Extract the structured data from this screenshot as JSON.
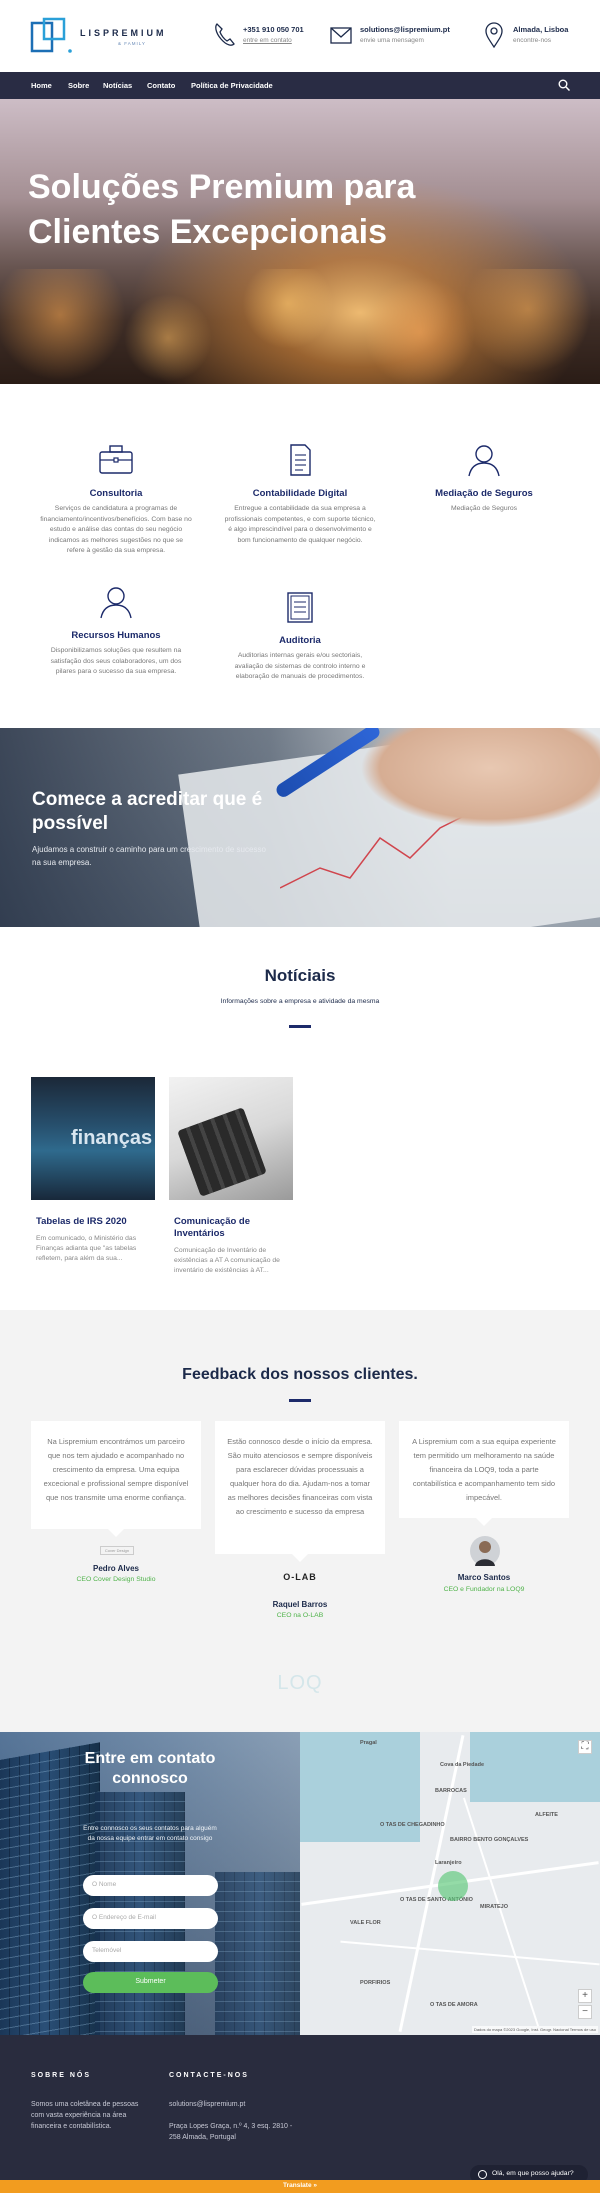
{
  "header": {
    "logo_text": "LISPREMIUM",
    "logo_sub": "& FAMILY",
    "phone": {
      "number": "+351 910 050 701",
      "sub": "entre em contato"
    },
    "email": {
      "address": "solutions@lispremium.pt",
      "sub": "envie uma mensagem"
    },
    "location": {
      "city": "Almada, Lisboa",
      "sub": "encontre-nos"
    }
  },
  "nav": {
    "items": [
      "Home",
      "Sobre",
      "Notícias",
      "Contato",
      "Política de Privacidade"
    ]
  },
  "hero": {
    "title": "Soluções Premium para Clientes Excepcionais"
  },
  "services": [
    {
      "icon": "briefcase-icon",
      "title": "Consultoria",
      "desc": "Serviços de candidatura a programas de financiamento/incentivos/benefícios. Com base no estudo e análise das contas do seu negócio indicamos as melhores sugestões no que se refere à gestão da sua empresa."
    },
    {
      "icon": "document-icon",
      "title": "Contabilidade Digital",
      "desc": "Entregue a contabilidade da sua empresa a profissionais competentes, e com suporte técnico, é algo imprescindível para o desenvolvimento e bom funcionamento de qualquer negócio."
    },
    {
      "icon": "user-icon",
      "title": "Mediação de Seguros",
      "desc": "Mediação de Seguros"
    },
    {
      "icon": "person-icon",
      "title": "Recursos Humanos",
      "desc": "Disponibilizamos soluções que resultem na satisfação dos seus colaboradores, um dos pilares para o sucesso da sua empresa."
    },
    {
      "icon": "clipboard-icon",
      "title": "Auditoria",
      "desc": "Auditorias internas gerais e/ou sectoriais, avaliação de sistemas de controlo interno e elaboração de manuais de procedimentos."
    }
  ],
  "banner": {
    "title": "Comece a acreditar que é possível",
    "text": "Ajudamos a construir o caminho para um crescimento de sucesso na sua empresa."
  },
  "news": {
    "title": "Notíciais",
    "subtitle": "Informações sobre a empresa e atividade da mesma",
    "cards": [
      {
        "title": "Tabelas de IRS 2020",
        "desc": "Em comunicado, o Ministério das Finanças adianta que \"as tabelas refletem, para além da sua...",
        "image_text": "finanças"
      },
      {
        "title": "Comunicação de Inventários",
        "desc": "Comunicação de Inventário de existências a AT A comunicação de inventário de existências à AT..."
      }
    ]
  },
  "feedback": {
    "title": "Feedback dos nossos clientes.",
    "testimonials": [
      {
        "text": "Na Lispremium encontrámos um parceiro que nos tem ajudado e acompanhado no crescimento da empresa. Uma equipa excecional e profissional sempre disponível que nos transmite uma enorme confiança.",
        "logo": "Cover Design",
        "name": "Pedro Alves",
        "role": "CEO Cover Design Studio"
      },
      {
        "text": "Estão connosco desde o início da empresa. São muito atenciosos e sempre disponíveis para esclarecer dúvidas processuais a qualquer hora do dia. Ajudam-nos a tomar as melhores decisões financeiras com vista ao crescimento e sucesso da empresa",
        "logo": "O-LAB",
        "name": "Raquel Barros",
        "role": "CEO na O-LAB"
      },
      {
        "text": "A Lispremium com a sua equipa experiente tem permitido um melhoramento na saúde financeira da LOQ9, toda a parte contabilística e acompanhamento tem sido impecável.",
        "logo": "",
        "name": "Marco Santos",
        "role": "CEO e Fundador na LOQ9"
      }
    ],
    "extra_logo": "LOQ"
  },
  "contact": {
    "title": "Entre em contato connosco",
    "lead": "Entre connosco os seus contatos para alguém da nossa equipe entrar em contato consigo",
    "placeholders": {
      "name": "O Nome",
      "email": "O Endereço de E-mail",
      "phone": "Telemóvel"
    },
    "submit": "Submeter"
  },
  "map": {
    "labels": [
      "Pragal",
      "Cova da Piedade",
      "BARROCAS",
      "ALFEITE",
      "O TAS DE CHEGADINHO",
      "BAIRRO BENTO GONÇALVES",
      "Laranjeiro",
      "O TAS DE SANTO ANTÓNIO",
      "MIRATEJO",
      "VALE FLOR",
      "PORFIRIOS",
      "O TAS DE AMORA"
    ],
    "attribution": "Dados do mapa ©2023 Google, Inst. Geogr. Nacional   Termos de uso"
  },
  "footer": {
    "about": {
      "heading": "SOBRE NÓS",
      "text": "Somos uma coletânea de pessoas com vasta experiência na área financeira e contabilística."
    },
    "contact": {
      "heading": "CONTACTE-NOS",
      "email": "solutions@lispremium.pt",
      "address": "Praça Lopes Graça, n.º 4, 3 esq. 2810 - 258 Almada, Portugal"
    }
  },
  "chat": {
    "label": "Olá, em que posso ajudar?"
  },
  "translate": {
    "label": "Translate »"
  },
  "colors": {
    "navy": "#1c2a6a",
    "nav_bg": "#292c44",
    "green": "#4fb34a",
    "orange": "#f29c1f"
  }
}
